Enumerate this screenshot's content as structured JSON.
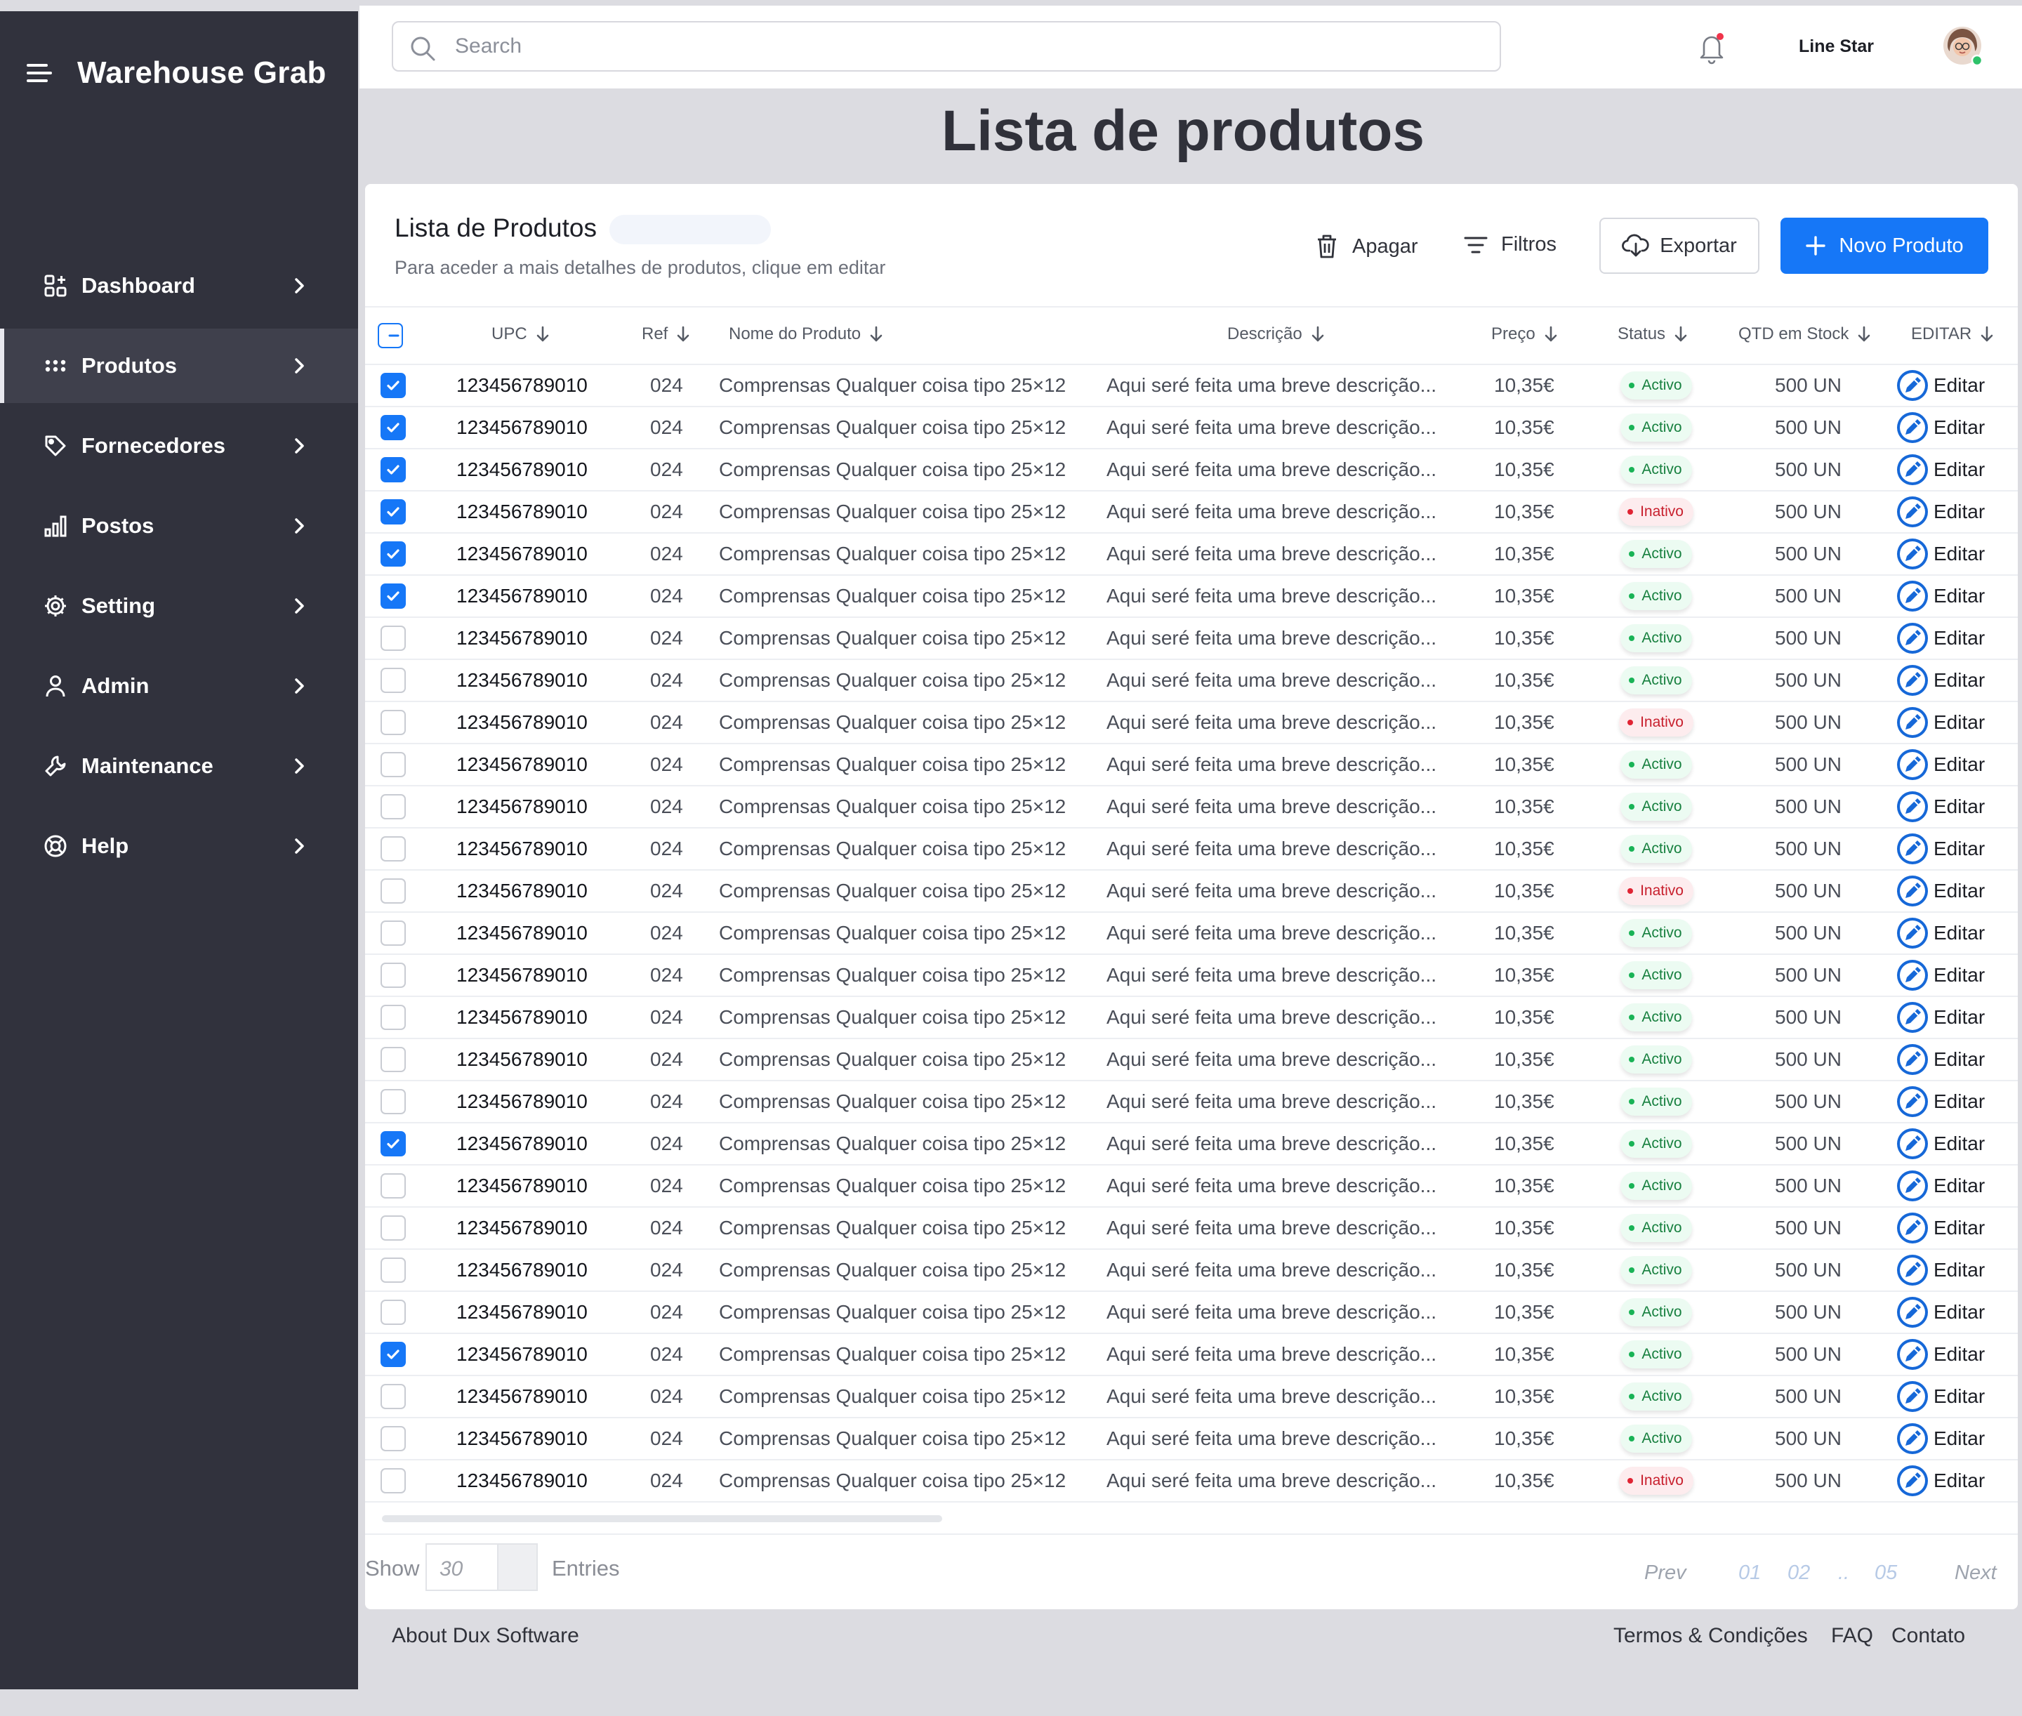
{
  "app": {
    "title": "Warehouse Grab"
  },
  "sidebar": {
    "items": [
      {
        "label": "Dashboard",
        "icon": "dashboard-icon",
        "active": false
      },
      {
        "label": "Produtos",
        "icon": "dots-grid-icon",
        "active": true
      },
      {
        "label": "Fornecedores",
        "icon": "tag-icon",
        "active": false
      },
      {
        "label": "Postos",
        "icon": "bar-chart-icon",
        "active": false
      },
      {
        "label": "Setting",
        "icon": "gear-icon",
        "active": false
      },
      {
        "label": "Admin",
        "icon": "user-icon",
        "active": false
      },
      {
        "label": "Maintenance",
        "icon": "wrench-icon",
        "active": false
      },
      {
        "label": "Help",
        "icon": "help-icon",
        "active": false
      }
    ]
  },
  "header": {
    "search_placeholder": "Search",
    "user_name": "Line Star",
    "notifications_icon": "bell-icon",
    "avatar_status": "online"
  },
  "page": {
    "title": "Lista de produtos"
  },
  "card": {
    "title": "Lista de Produtos",
    "subtitle": "Para aceder a mais detalhes de produtos, clique em editar",
    "actions": {
      "delete": "Apagar",
      "filters": "Filtros",
      "export": "Exportar",
      "new": "Novo Produto"
    }
  },
  "table": {
    "columns": {
      "upc": "UPC",
      "ref": "Ref",
      "name": "Nome do Produto",
      "desc": "Descrição",
      "price": "Preço",
      "status": "Status",
      "qty": "QTD em Stock",
      "edit": "EDITAR"
    },
    "header_checkbox": "indeterminate",
    "edit_label": "Editar",
    "rows": [
      {
        "upc": "123456789010",
        "ref": "024",
        "name": "Comprensas Qualquer coisa tipo 25×12",
        "desc": "Aqui seré feita uma breve descrição...",
        "price": "10,35€",
        "status": "Activo",
        "qty": "500 UN",
        "checked": true
      },
      {
        "upc": "123456789010",
        "ref": "024",
        "name": "Comprensas Qualquer coisa tipo 25×12",
        "desc": "Aqui seré feita uma breve descrição...",
        "price": "10,35€",
        "status": "Activo",
        "qty": "500 UN",
        "checked": true
      },
      {
        "upc": "123456789010",
        "ref": "024",
        "name": "Comprensas Qualquer coisa tipo 25×12",
        "desc": "Aqui seré feita uma breve descrição...",
        "price": "10,35€",
        "status": "Activo",
        "qty": "500 UN",
        "checked": true
      },
      {
        "upc": "123456789010",
        "ref": "024",
        "name": "Comprensas Qualquer coisa tipo 25×12",
        "desc": "Aqui seré feita uma breve descrição...",
        "price": "10,35€",
        "status": "Inativo",
        "qty": "500 UN",
        "checked": true
      },
      {
        "upc": "123456789010",
        "ref": "024",
        "name": "Comprensas Qualquer coisa tipo 25×12",
        "desc": "Aqui seré feita uma breve descrição...",
        "price": "10,35€",
        "status": "Activo",
        "qty": "500 UN",
        "checked": true
      },
      {
        "upc": "123456789010",
        "ref": "024",
        "name": "Comprensas Qualquer coisa tipo 25×12",
        "desc": "Aqui seré feita uma breve descrição...",
        "price": "10,35€",
        "status": "Activo",
        "qty": "500 UN",
        "checked": true
      },
      {
        "upc": "123456789010",
        "ref": "024",
        "name": "Comprensas Qualquer coisa tipo 25×12",
        "desc": "Aqui seré feita uma breve descrição...",
        "price": "10,35€",
        "status": "Activo",
        "qty": "500 UN",
        "checked": false
      },
      {
        "upc": "123456789010",
        "ref": "024",
        "name": "Comprensas Qualquer coisa tipo 25×12",
        "desc": "Aqui seré feita uma breve descrição...",
        "price": "10,35€",
        "status": "Activo",
        "qty": "500 UN",
        "checked": false
      },
      {
        "upc": "123456789010",
        "ref": "024",
        "name": "Comprensas Qualquer coisa tipo 25×12",
        "desc": "Aqui seré feita uma breve descrição...",
        "price": "10,35€",
        "status": "Inativo",
        "qty": "500 UN",
        "checked": false
      },
      {
        "upc": "123456789010",
        "ref": "024",
        "name": "Comprensas Qualquer coisa tipo 25×12",
        "desc": "Aqui seré feita uma breve descrição...",
        "price": "10,35€",
        "status": "Activo",
        "qty": "500 UN",
        "checked": false
      },
      {
        "upc": "123456789010",
        "ref": "024",
        "name": "Comprensas Qualquer coisa tipo 25×12",
        "desc": "Aqui seré feita uma breve descrição...",
        "price": "10,35€",
        "status": "Activo",
        "qty": "500 UN",
        "checked": false
      },
      {
        "upc": "123456789010",
        "ref": "024",
        "name": "Comprensas Qualquer coisa tipo 25×12",
        "desc": "Aqui seré feita uma breve descrição...",
        "price": "10,35€",
        "status": "Activo",
        "qty": "500 UN",
        "checked": false
      },
      {
        "upc": "123456789010",
        "ref": "024",
        "name": "Comprensas Qualquer coisa tipo 25×12",
        "desc": "Aqui seré feita uma breve descrição...",
        "price": "10,35€",
        "status": "Inativo",
        "qty": "500 UN",
        "checked": false
      },
      {
        "upc": "123456789010",
        "ref": "024",
        "name": "Comprensas Qualquer coisa tipo 25×12",
        "desc": "Aqui seré feita uma breve descrição...",
        "price": "10,35€",
        "status": "Activo",
        "qty": "500 UN",
        "checked": false
      },
      {
        "upc": "123456789010",
        "ref": "024",
        "name": "Comprensas Qualquer coisa tipo 25×12",
        "desc": "Aqui seré feita uma breve descrição...",
        "price": "10,35€",
        "status": "Activo",
        "qty": "500 UN",
        "checked": false
      },
      {
        "upc": "123456789010",
        "ref": "024",
        "name": "Comprensas Qualquer coisa tipo 25×12",
        "desc": "Aqui seré feita uma breve descrição...",
        "price": "10,35€",
        "status": "Activo",
        "qty": "500 UN",
        "checked": false
      },
      {
        "upc": "123456789010",
        "ref": "024",
        "name": "Comprensas Qualquer coisa tipo 25×12",
        "desc": "Aqui seré feita uma breve descrição...",
        "price": "10,35€",
        "status": "Activo",
        "qty": "500 UN",
        "checked": false
      },
      {
        "upc": "123456789010",
        "ref": "024",
        "name": "Comprensas Qualquer coisa tipo 25×12",
        "desc": "Aqui seré feita uma breve descrição...",
        "price": "10,35€",
        "status": "Activo",
        "qty": "500 UN",
        "checked": false
      },
      {
        "upc": "123456789010",
        "ref": "024",
        "name": "Comprensas Qualquer coisa tipo 25×12",
        "desc": "Aqui seré feita uma breve descrição...",
        "price": "10,35€",
        "status": "Activo",
        "qty": "500 UN",
        "checked": true
      },
      {
        "upc": "123456789010",
        "ref": "024",
        "name": "Comprensas Qualquer coisa tipo 25×12",
        "desc": "Aqui seré feita uma breve descrição...",
        "price": "10,35€",
        "status": "Activo",
        "qty": "500 UN",
        "checked": false
      },
      {
        "upc": "123456789010",
        "ref": "024",
        "name": "Comprensas Qualquer coisa tipo 25×12",
        "desc": "Aqui seré feita uma breve descrição...",
        "price": "10,35€",
        "status": "Activo",
        "qty": "500 UN",
        "checked": false
      },
      {
        "upc": "123456789010",
        "ref": "024",
        "name": "Comprensas Qualquer coisa tipo 25×12",
        "desc": "Aqui seré feita uma breve descrição...",
        "price": "10,35€",
        "status": "Activo",
        "qty": "500 UN",
        "checked": false
      },
      {
        "upc": "123456789010",
        "ref": "024",
        "name": "Comprensas Qualquer coisa tipo 25×12",
        "desc": "Aqui seré feita uma breve descrição...",
        "price": "10,35€",
        "status": "Activo",
        "qty": "500 UN",
        "checked": false
      },
      {
        "upc": "123456789010",
        "ref": "024",
        "name": "Comprensas Qualquer coisa tipo 25×12",
        "desc": "Aqui seré feita uma breve descrição...",
        "price": "10,35€",
        "status": "Activo",
        "qty": "500 UN",
        "checked": true
      },
      {
        "upc": "123456789010",
        "ref": "024",
        "name": "Comprensas Qualquer coisa tipo 25×12",
        "desc": "Aqui seré feita uma breve descrição...",
        "price": "10,35€",
        "status": "Activo",
        "qty": "500 UN",
        "checked": false
      },
      {
        "upc": "123456789010",
        "ref": "024",
        "name": "Comprensas Qualquer coisa tipo 25×12",
        "desc": "Aqui seré feita uma breve descrição...",
        "price": "10,35€",
        "status": "Activo",
        "qty": "500 UN",
        "checked": false
      },
      {
        "upc": "123456789010",
        "ref": "024",
        "name": "Comprensas Qualquer coisa tipo 25×12",
        "desc": "Aqui seré feita uma breve descrição...",
        "price": "10,35€",
        "status": "Inativo",
        "qty": "500 UN",
        "checked": false
      }
    ]
  },
  "pagination": {
    "show_label": "Show",
    "entries_value": "30",
    "entries_label": "Entries",
    "prev": "Prev",
    "pages": [
      "01",
      "02",
      "..",
      "05"
    ],
    "next": "Next"
  },
  "footer": {
    "about": "About Dux Software",
    "terms": "Termos & Condições",
    "faq": "FAQ",
    "contact": "Contato"
  },
  "colors": {
    "sidebar": "#31323d",
    "primary": "#1677f7",
    "active_text": "#17803f",
    "inactive_text": "#c8202e",
    "background": "#dcdce1"
  }
}
